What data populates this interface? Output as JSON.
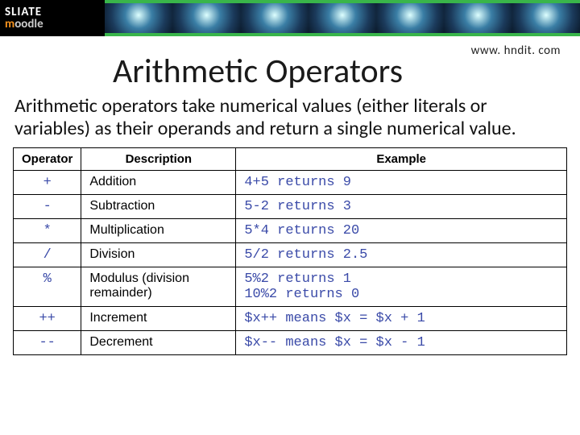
{
  "banner": {
    "logo_line1": "SLIATE",
    "logo_line2a": "m",
    "logo_line2b": "oodle"
  },
  "site_url": "www. hndit. com",
  "title": "Arithmetic Operators",
  "description": "Arithmetic operators take numerical values (either literals or variables) as their operands and return a single numerical value.",
  "table": {
    "headers": [
      "Operator",
      "Description",
      "Example"
    ],
    "rows": [
      {
        "op": "+",
        "desc": "Addition",
        "ex": "4+5 returns 9"
      },
      {
        "op": "-",
        "desc": "Subtraction",
        "ex": "5-2 returns 3"
      },
      {
        "op": "*",
        "desc": "Multiplication",
        "ex": "5*4 returns 20"
      },
      {
        "op": "/",
        "desc": "Division",
        "ex": "5/2 returns 2.5"
      },
      {
        "op": "%",
        "desc": "Modulus (division remainder)",
        "ex": "5%2 returns 1\n10%2 returns 0"
      },
      {
        "op": "++",
        "desc": "Increment",
        "ex": "$x++ means $x = $x + 1"
      },
      {
        "op": "--",
        "desc": "Decrement",
        "ex": "$x-- means $x = $x - 1"
      }
    ]
  }
}
